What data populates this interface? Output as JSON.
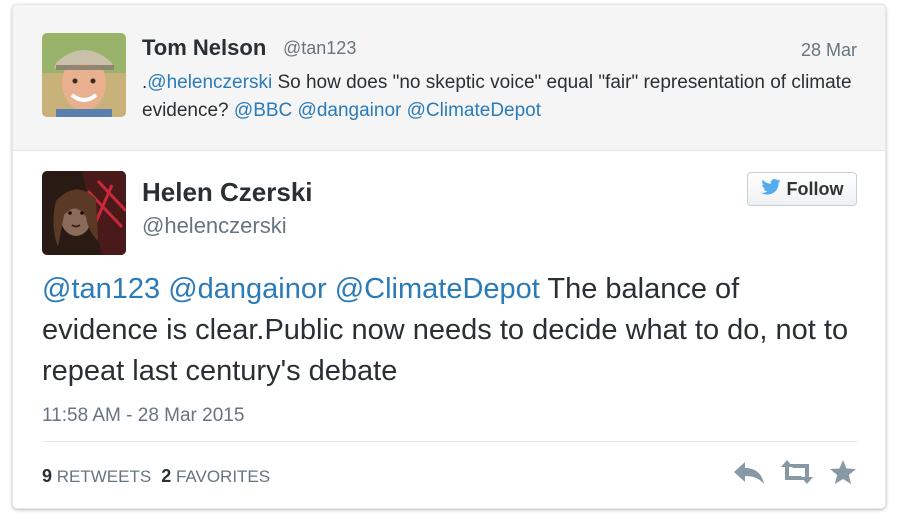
{
  "parent_tweet": {
    "name": "Tom Nelson",
    "handle": "@tan123",
    "date": "28 Mar",
    "text_parts": [
      {
        "text": ".",
        "type": "plain"
      },
      {
        "text": "@helenczerski",
        "type": "mention"
      },
      {
        "text": " So how does \"no skeptic voice\" equal \"fair\" representation of climate evidence? ",
        "type": "plain"
      },
      {
        "text": "@BBC",
        "type": "mention"
      },
      {
        "text": " ",
        "type": "plain"
      },
      {
        "text": "@dangainor",
        "type": "mention"
      },
      {
        "text": " ",
        "type": "plain"
      },
      {
        "text": "@ClimateDepot",
        "type": "mention"
      }
    ]
  },
  "main_tweet": {
    "name": "Helen Czerski",
    "handle": "@helenczerski",
    "follow_label": "Follow",
    "text_parts": [
      {
        "text": "@tan123",
        "type": "mention"
      },
      {
        "text": " ",
        "type": "plain"
      },
      {
        "text": "@dangainor",
        "type": "mention"
      },
      {
        "text": " ",
        "type": "plain"
      },
      {
        "text": "@ClimateDepot",
        "type": "mention"
      },
      {
        "text": " The balance of evidence is clear.Public now needs to decide what to do, not to repeat last century's debate",
        "type": "plain"
      }
    ],
    "timestamp": "11:58 AM - 28 Mar 2015",
    "retweets_count": "9",
    "retweets_label": "RETWEETS",
    "favorites_count": "2",
    "favorites_label": "FAVORITES"
  },
  "icons": [
    "twitter-bird-icon",
    "reply-icon",
    "retweet-icon",
    "favorite-star-icon"
  ],
  "colors": {
    "mention": "#2b7bb9",
    "twitter_blue": "#55acee",
    "text": "#292f33",
    "muted": "#66757f",
    "parent_bg": "#f5f5f5",
    "action_icon": "#8899a6"
  }
}
